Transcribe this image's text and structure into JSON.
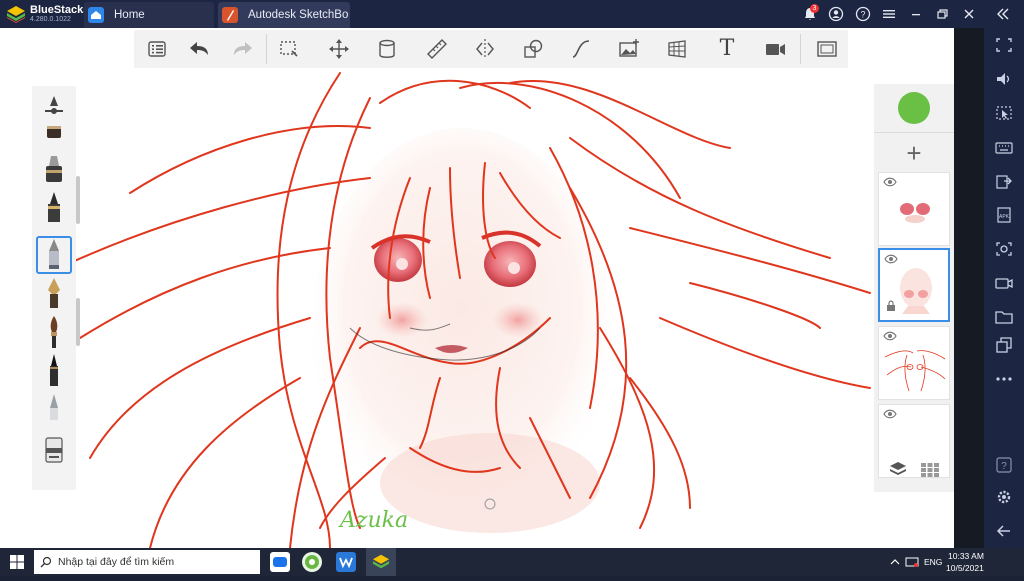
{
  "titlebar": {
    "brand": "BlueStacks",
    "version": "4.280.0.1022",
    "tabs": [
      {
        "label": "Home",
        "icon": "home-icon"
      },
      {
        "label": "Autodesk SketchBook",
        "icon": "sketchbook-icon"
      }
    ],
    "notification_count": "3",
    "controls": [
      "notification-icon",
      "account-icon",
      "help-icon",
      "menu-icon",
      "minimize-icon",
      "restore-icon",
      "close-icon",
      "collapse-sidebar-icon"
    ]
  },
  "right_rail": {
    "icons": [
      "fullscreen-icon",
      "volume-icon",
      "pointer-icon",
      "keyboard-icon",
      "install-apk-icon",
      "apk-icon",
      "screenshot-icon",
      "record-icon",
      "folder-icon",
      "multi-instance-icon",
      "more-icon",
      "help-icon",
      "settings-icon",
      "back-icon"
    ]
  },
  "toolbar": {
    "tools": [
      "list-icon",
      "undo-icon",
      "redo-icon",
      "selection-icon",
      "transform-icon",
      "fill-icon",
      "ruler-icon",
      "symmetry-icon",
      "shape-icon",
      "stroke-icon",
      "image-icon",
      "perspective-icon",
      "text-icon",
      "camera-icon",
      "fullscreen-icon"
    ],
    "text_tool_label": "T"
  },
  "brushes": [
    "brush-size-icon",
    "brush-ink-icon",
    "marker-icon",
    "pen-icon",
    "pencil-icon",
    "fountain-pen-icon",
    "paint-brush-icon",
    "ink-brush-icon",
    "airbrush-icon",
    "eraser-icon"
  ],
  "layers": {
    "color_hex": "#6abf45",
    "add_label": "+",
    "items": [
      {
        "name": "layer-1",
        "selected": false,
        "locked": false
      },
      {
        "name": "layer-2",
        "selected": true,
        "locked": true
      },
      {
        "name": "layer-3",
        "selected": false,
        "locked": false
      },
      {
        "name": "layer-4",
        "selected": false,
        "locked": false
      }
    ]
  },
  "canvas": {
    "signature": "Azuka"
  },
  "taskbar": {
    "search_placeholder": "Nhập tại đây để tìm kiếm",
    "apps": [
      "zalo-icon",
      "coccoc-icon",
      "wps-icon",
      "bluestacks-icon"
    ],
    "tray": {
      "lang": "ENG",
      "time": "10:33 AM",
      "date": "10/5/2021"
    }
  }
}
